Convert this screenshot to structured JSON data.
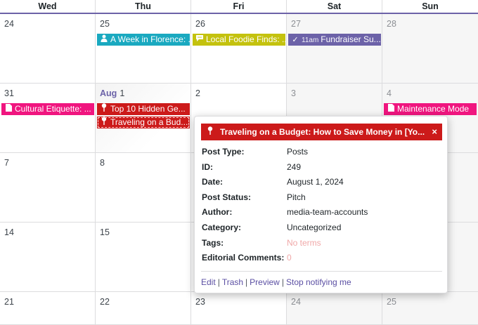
{
  "colors": {
    "teal": "#1aa9c0",
    "olive": "#c4c20e",
    "purple": "#6c62a8",
    "pink": "#f0157f",
    "red": "#cc1a1a"
  },
  "days": [
    "Wed",
    "Thu",
    "Fri",
    "Sat",
    "Sun"
  ],
  "weeks": [
    {
      "cells": [
        {
          "num": "24"
        },
        {
          "num": "25"
        },
        {
          "num": "26"
        },
        {
          "num": "27"
        },
        {
          "num": "28"
        }
      ]
    },
    {
      "cells": [
        {
          "num": "31"
        },
        {
          "month": "Aug",
          "num": "1"
        },
        {
          "num": "2"
        },
        {
          "num": "3"
        },
        {
          "num": "4"
        }
      ]
    },
    {
      "cells": [
        {
          "num": "7"
        },
        {
          "num": "8"
        },
        {
          "num": ""
        },
        {
          "num": ""
        },
        {
          "num": ""
        }
      ]
    },
    {
      "cells": [
        {
          "num": "14"
        },
        {
          "num": "15"
        },
        {
          "num": ""
        },
        {
          "num": ""
        },
        {
          "num": ""
        }
      ]
    },
    {
      "cells": [
        {
          "num": "21"
        },
        {
          "num": "22"
        },
        {
          "num": "23"
        },
        {
          "num": "24"
        },
        {
          "num": "25"
        }
      ]
    }
  ],
  "events": {
    "florence": {
      "title": "A Week in Florence: ...",
      "icon": "person-icon"
    },
    "foodie": {
      "title": "Local Foodie Finds: ...",
      "icon": "speech-bubble-icon"
    },
    "fundraiser": {
      "time": "11am",
      "title": "Fundraiser Su...",
      "icon": "checkmark-icon"
    },
    "etiquette": {
      "title": "Cultural Etiquette: ...",
      "icon": "document-icon"
    },
    "hidden_gems": {
      "title": "Top 10 Hidden Ge...",
      "icon": "pin-icon"
    },
    "budget": {
      "title": "Traveling on a Bud...",
      "icon": "pin-icon"
    },
    "maintenance": {
      "title": "Maintenance Mode",
      "icon": "document-icon"
    }
  },
  "popup": {
    "title": "Traveling on a Budget: How to Save Money in [Yo...",
    "close": "×",
    "rows": [
      {
        "key": "Post Type:",
        "value": "Posts"
      },
      {
        "key": "ID:",
        "value": "249"
      },
      {
        "key": "Date:",
        "value": "August 1, 2024"
      },
      {
        "key": "Post Status:",
        "value": "Pitch"
      },
      {
        "key": "Author:",
        "value": "media-team-accounts"
      },
      {
        "key": "Category:",
        "value": "Uncategorized"
      },
      {
        "key": "Tags:",
        "value": "No terms"
      },
      {
        "key": "Editorial Comments:",
        "value": "0"
      }
    ],
    "links": {
      "edit": "Edit",
      "trash": "Trash",
      "preview": "Preview",
      "stop": "Stop notifying me",
      "separator": "|"
    }
  }
}
